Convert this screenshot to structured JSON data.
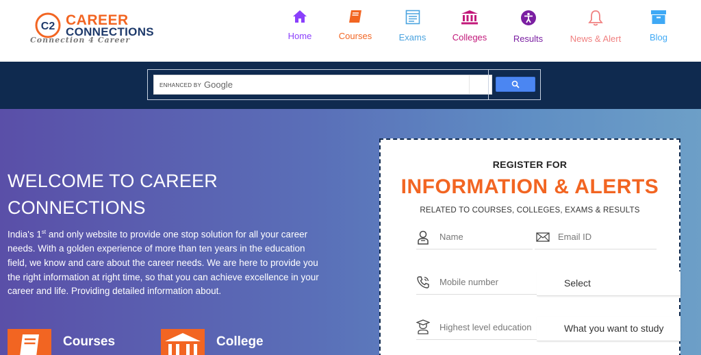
{
  "brand": {
    "mark": "C2",
    "line1": "CAREER",
    "line2": "CONNECTIONS",
    "tagline": "Connection 4 Career"
  },
  "nav": [
    {
      "label": "Home",
      "icon": "home-icon",
      "color": "#8a3ffc"
    },
    {
      "label": "Courses",
      "icon": "book-icon",
      "color": "#f26522"
    },
    {
      "label": "Exams",
      "icon": "exam-sheet-icon",
      "color": "#4aa3df"
    },
    {
      "label": "Colleges",
      "icon": "college-building-icon",
      "color": "#c2187a"
    },
    {
      "label": "Results",
      "icon": "accessibility-icon",
      "color": "#7b1fa2"
    },
    {
      "label": "News & Alert",
      "icon": "bell-icon",
      "color": "#f08080"
    },
    {
      "label": "Blog",
      "icon": "archive-box-icon",
      "color": "#3fa9f5"
    }
  ],
  "search": {
    "enhanced_by": "ENHANCED BY",
    "provider": "Google",
    "button_icon": "search-icon"
  },
  "hero": {
    "title_line1": "WELCOME TO CAREER",
    "title_line2": "CONNECTIONS",
    "intro_pre": "India's 1",
    "intro_sup": "st",
    "intro_post": " and only website to provide one stop solution for all your career needs. With a golden experience of more than ten years in the education field, we know and care about the career needs. We are here to provide you the right information at right time, so that you can achieve excellence in your career and life. Providing detailed information about.",
    "features": [
      {
        "label": "Courses",
        "icon": "book-icon"
      },
      {
        "label": "College",
        "icon": "college-building-icon"
      }
    ]
  },
  "register": {
    "heading": "REGISTER FOR",
    "title": "INFORMATION & ALERTS",
    "subtitle": "RELATED TO COURSES, COLLEGES, EXAMS & RESULTS",
    "name_placeholder": "Name",
    "email_placeholder": "Email ID",
    "mobile_placeholder": "Mobile number",
    "select_label": "Select",
    "education_placeholder": "Highest level education",
    "study_label": "What you want to study"
  },
  "colors": {
    "accent": "#f26522",
    "navy": "#0f2a4f",
    "search_button": "#4b86f2"
  }
}
